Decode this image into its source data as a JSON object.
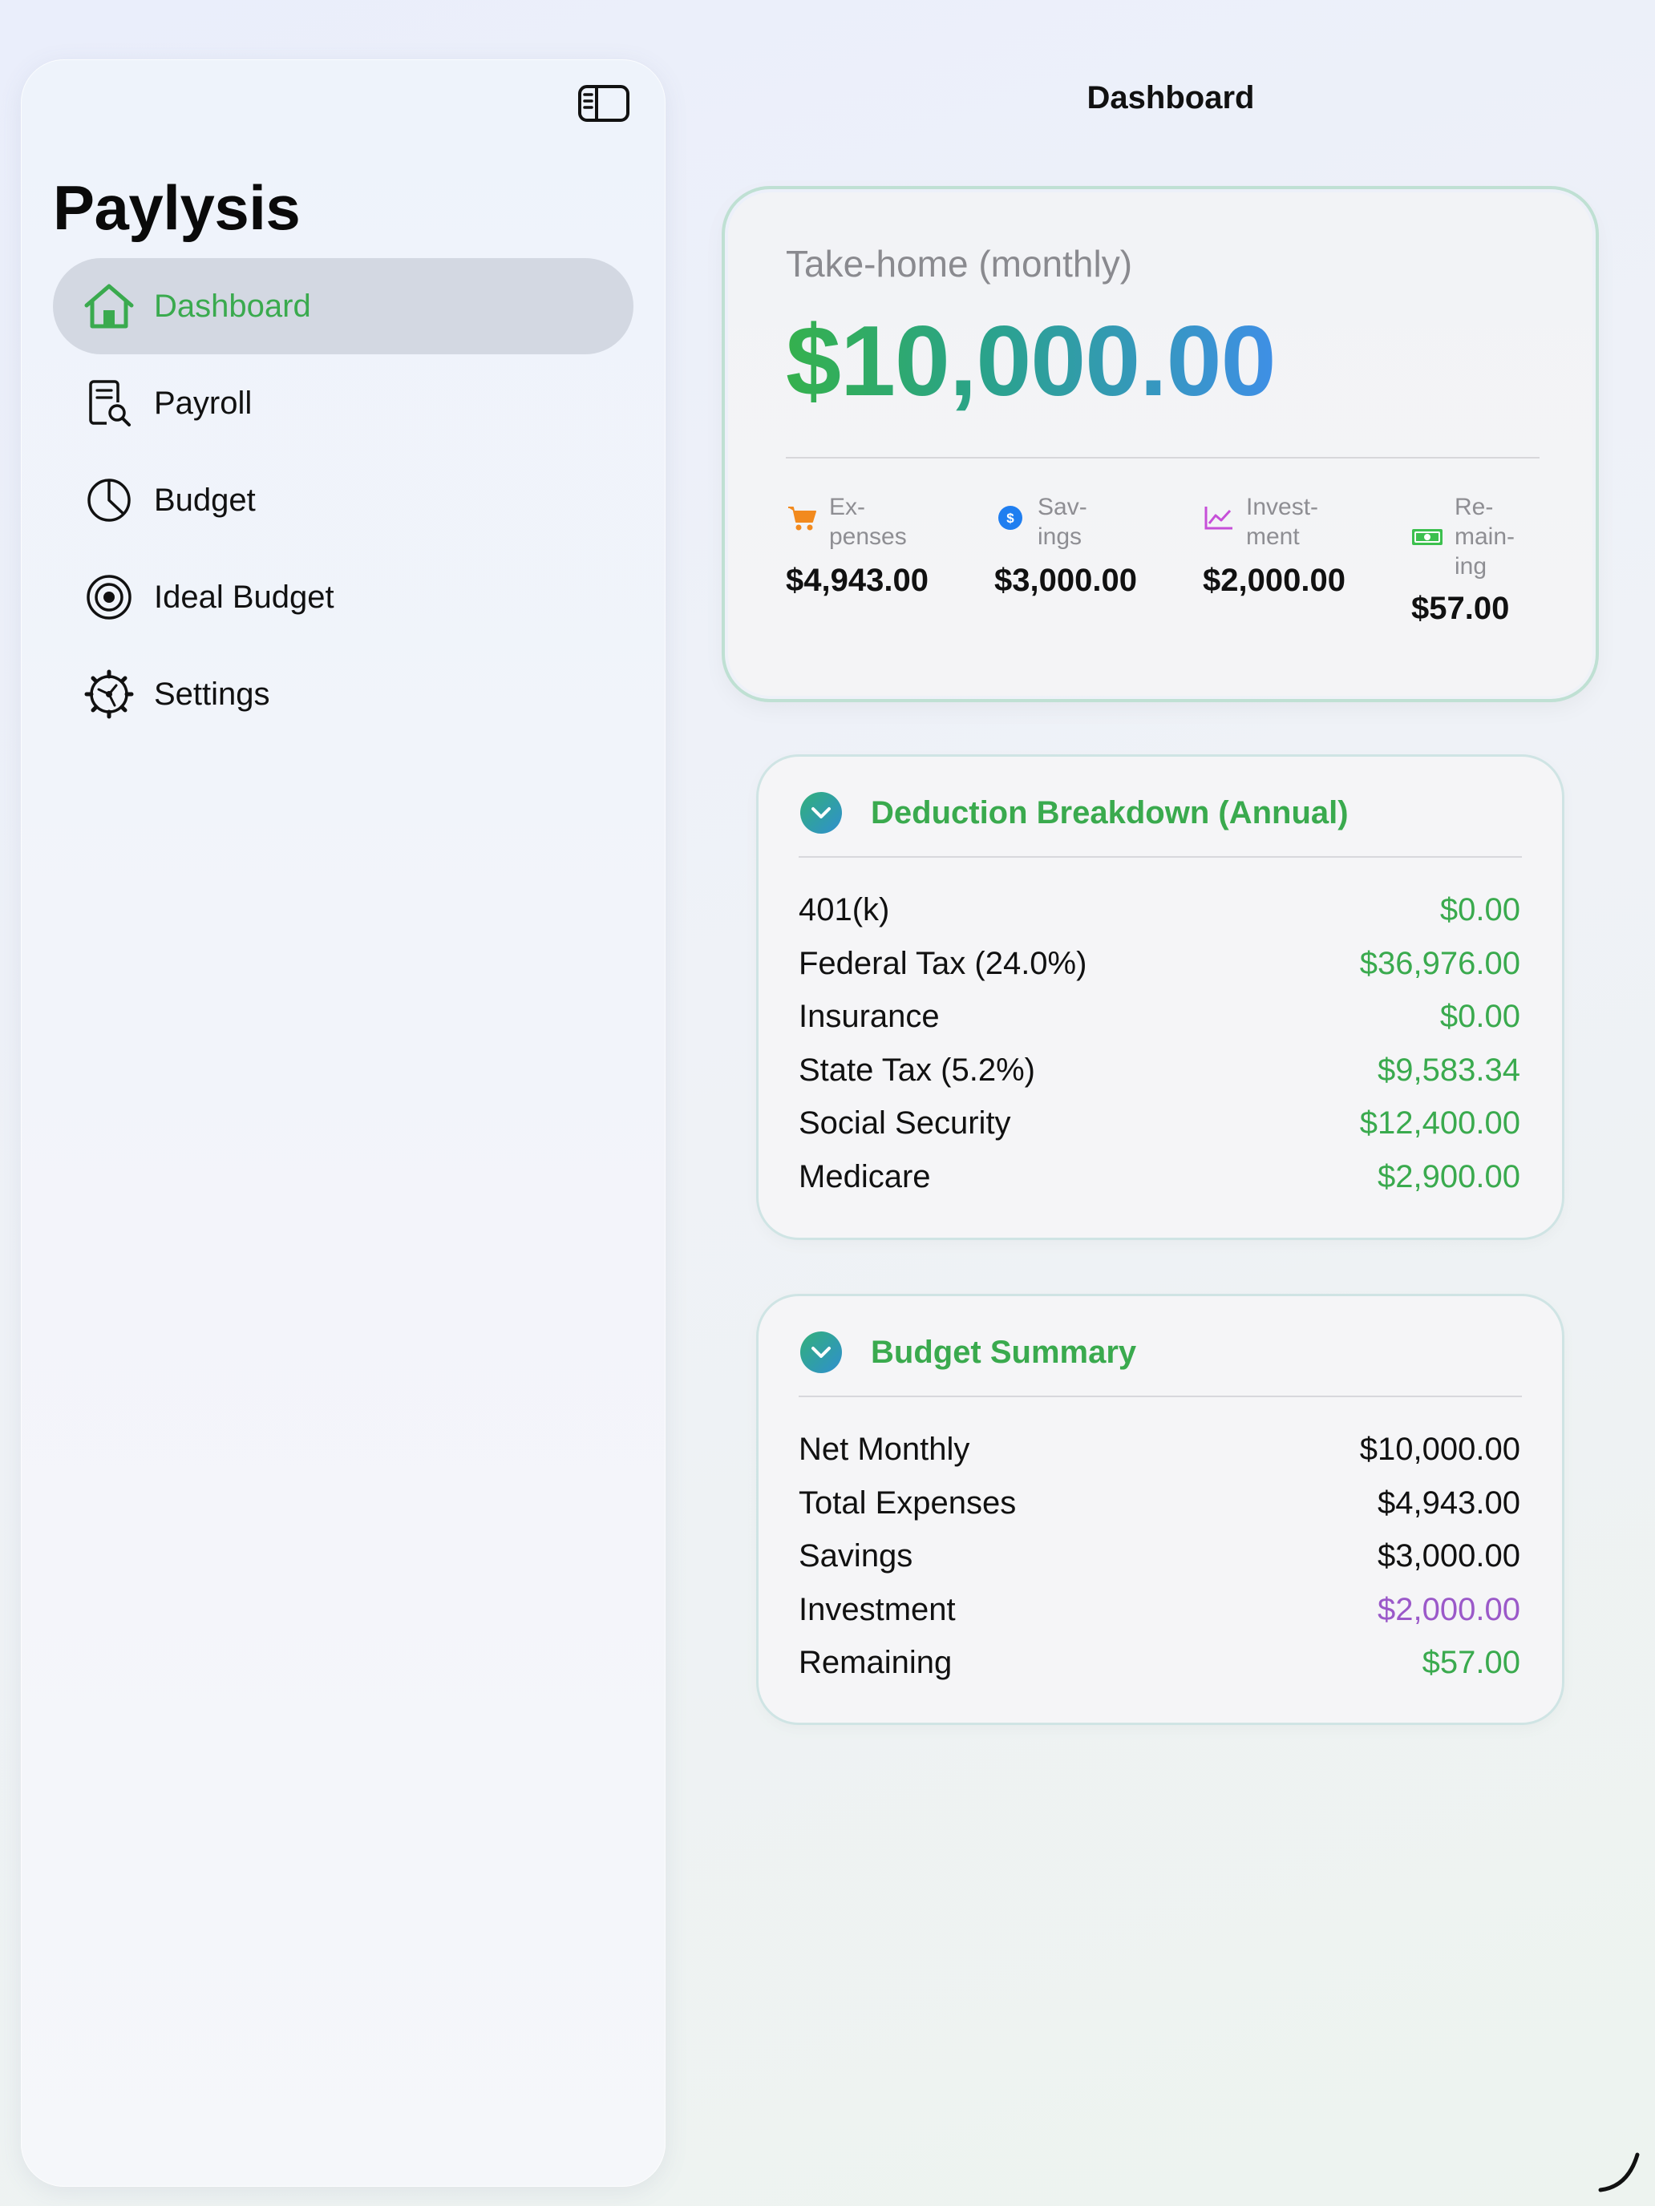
{
  "sidebar": {
    "app_title": "Paylysis",
    "items": [
      {
        "label": "Dashboard",
        "icon": "house-icon",
        "active": true
      },
      {
        "label": "Payroll",
        "icon": "document-search-icon",
        "active": false
      },
      {
        "label": "Budget",
        "icon": "pie-chart-icon",
        "active": false
      },
      {
        "label": "Ideal Budget",
        "icon": "target-icon",
        "active": false
      },
      {
        "label": "Settings",
        "icon": "gear-icon",
        "active": false
      }
    ]
  },
  "header": {
    "title": "Dashboard"
  },
  "hero": {
    "label": "Take-home (monthly)",
    "amount": "$10,000.00",
    "stats": [
      {
        "label": "Ex-\npenses",
        "value": "$4,943.00",
        "icon": "cart-icon",
        "color": "#f28a1e"
      },
      {
        "label": "Sav-\nings",
        "value": "$3,000.00",
        "icon": "dollar-coin-icon",
        "color": "#1f7ef0"
      },
      {
        "label": "Invest-\nment",
        "value": "$2,000.00",
        "icon": "trend-chart-icon",
        "color": "#c64fd8"
      },
      {
        "label": "Re-\nmain-\ning",
        "value": "$57.00",
        "icon": "banknote-icon",
        "color": "#3cc04e"
      }
    ]
  },
  "deductions": {
    "title": "Deduction Breakdown (Annual)",
    "rows": [
      {
        "label": "401(k)",
        "value": "$0.00"
      },
      {
        "label": "Federal Tax (24.0%)",
        "value": "$36,976.00"
      },
      {
        "label": "Insurance",
        "value": "$0.00"
      },
      {
        "label": "State Tax (5.2%)",
        "value": "$9,583.34"
      },
      {
        "label": "Social Security",
        "value": "$12,400.00"
      },
      {
        "label": "Medicare",
        "value": "$2,900.00"
      }
    ]
  },
  "budget_summary": {
    "title": "Budget Summary",
    "rows": [
      {
        "label": "Net Monthly",
        "value": "$10,000.00",
        "color": "black"
      },
      {
        "label": "Total Expenses",
        "value": "$4,943.00",
        "color": "black"
      },
      {
        "label": "Savings",
        "value": "$3,000.00",
        "color": "black"
      },
      {
        "label": "Investment",
        "value": "$2,000.00",
        "color": "purple"
      },
      {
        "label": "Remaining",
        "value": "$57.00",
        "color": "green"
      }
    ]
  },
  "colors": {
    "accent_green": "#3aaa4e",
    "purple": "#9b59c9"
  }
}
